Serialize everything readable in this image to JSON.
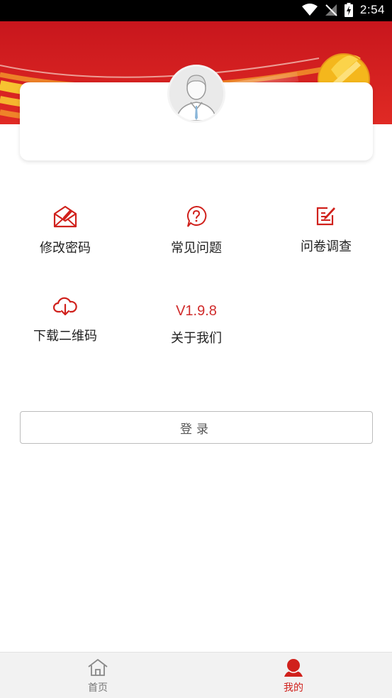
{
  "status_bar": {
    "time": "2:54"
  },
  "menu": {
    "items": [
      {
        "label": "修改密码",
        "icon": "envelope-pen-icon"
      },
      {
        "label": "常见问题",
        "icon": "question-bubble-icon"
      },
      {
        "label": "问卷调查",
        "icon": "survey-edit-icon"
      },
      {
        "label": "下载二维码",
        "icon": "cloud-download-icon"
      },
      {
        "label": "关于我们",
        "version": "V1.9.8"
      }
    ]
  },
  "login": {
    "label": "登录"
  },
  "tabbar": {
    "tabs": [
      {
        "label": "首页",
        "icon": "home-icon",
        "active": false
      },
      {
        "label": "我的",
        "icon": "profile-icon",
        "active": true
      }
    ]
  },
  "colors": {
    "accent": "#d0211c",
    "banner_gold": "#f7c531",
    "inactive": "#777777"
  }
}
